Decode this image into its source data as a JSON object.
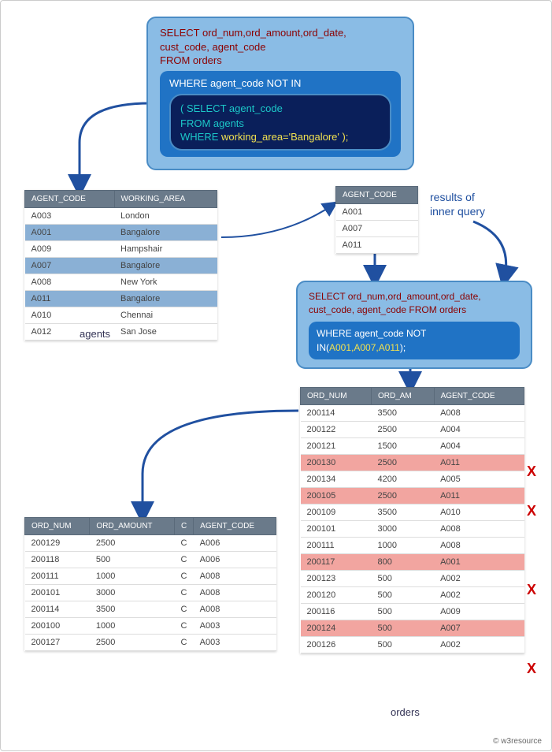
{
  "sql1": {
    "select": "SELECT ord_num,ord_amount,ord_date,",
    "select2": "cust_code, agent_code",
    "from": "FROM orders",
    "where": "WHERE agent_code NOT IN",
    "inner_select": "( SELECT agent_code",
    "inner_from": "FROM agents",
    "inner_where_pre": "WHERE ",
    "inner_where_yellow": "working_area='Bangalore' );"
  },
  "agents": {
    "headers": [
      "AGENT_CODE",
      "WORKING_AREA"
    ],
    "rows": [
      {
        "code": "A003",
        "area": "London",
        "hl": false
      },
      {
        "code": "A001",
        "area": "Bangalore",
        "hl": true
      },
      {
        "code": "A009",
        "area": "Hampshair",
        "hl": false
      },
      {
        "code": "A007",
        "area": "Bangalore",
        "hl": true
      },
      {
        "code": "A008",
        "area": "New York",
        "hl": false
      },
      {
        "code": "A011",
        "area": "Bangalore",
        "hl": true
      },
      {
        "code": "A010",
        "area": "Chennai",
        "hl": false
      },
      {
        "code": "A012",
        "area": "San Jose",
        "hl": false
      }
    ],
    "label": "agents"
  },
  "inner_result": {
    "header": "AGENT_CODE",
    "rows": [
      "A001",
      "A007",
      "A011"
    ],
    "label": "results of\ninner query"
  },
  "sql2": {
    "select": "SELECT ord_num,ord_amount,ord_date,",
    "select2": "cust_code, agent_code FROM orders",
    "where_pre": "WHERE agent_code NOT IN(",
    "where_yellow": "A001,A007,A011",
    "where_post": ");"
  },
  "orders": {
    "headers": [
      "ORD_NUM",
      "ORD_AM",
      "AGENT_CODE"
    ],
    "rows": [
      {
        "num": "200114",
        "amt": "3500",
        "agent": "A008",
        "x": false
      },
      {
        "num": "200122",
        "amt": "2500",
        "agent": "A004",
        "x": false
      },
      {
        "num": "200121",
        "amt": "1500",
        "agent": "A004",
        "x": false
      },
      {
        "num": "200130",
        "amt": "2500",
        "agent": "A011",
        "x": true
      },
      {
        "num": "200134",
        "amt": "4200",
        "agent": "A005",
        "x": false
      },
      {
        "num": "200105",
        "amt": "2500",
        "agent": "A011",
        "x": true
      },
      {
        "num": "200109",
        "amt": "3500",
        "agent": "A010",
        "x": false
      },
      {
        "num": "200101",
        "amt": "3000",
        "agent": "A008",
        "x": false
      },
      {
        "num": "200111",
        "amt": "1000",
        "agent": "A008",
        "x": false
      },
      {
        "num": "200117",
        "amt": "800",
        "agent": "A001",
        "x": true
      },
      {
        "num": "200123",
        "amt": "500",
        "agent": "A002",
        "x": false
      },
      {
        "num": "200120",
        "amt": "500",
        "agent": "A002",
        "x": false
      },
      {
        "num": "200116",
        "amt": "500",
        "agent": "A009",
        "x": false
      },
      {
        "num": "200124",
        "amt": "500",
        "agent": "A007",
        "x": true
      },
      {
        "num": "200126",
        "amt": "500",
        "agent": "A002",
        "x": false
      }
    ],
    "label": "orders"
  },
  "final": {
    "headers": [
      "ORD_NUM",
      "ORD_AMOUNT",
      "C",
      "AGENT_CODE"
    ],
    "rows": [
      {
        "num": "200129",
        "amt": "2500",
        "c": "C",
        "agent": "A006"
      },
      {
        "num": "200118",
        "amt": "500",
        "c": "C",
        "agent": "A006"
      },
      {
        "num": "200111",
        "amt": "1000",
        "c": "C",
        "agent": "A008"
      },
      {
        "num": "200101",
        "amt": "3000",
        "c": "C",
        "agent": "A008"
      },
      {
        "num": "200114",
        "amt": "3500",
        "c": "C",
        "agent": "A008"
      },
      {
        "num": "200100",
        "amt": "1000",
        "c": "C",
        "agent": "A003"
      },
      {
        "num": "200127",
        "amt": "2500",
        "c": "C",
        "agent": "A003"
      }
    ]
  },
  "x_mark": "X",
  "credit": "© w3resource"
}
